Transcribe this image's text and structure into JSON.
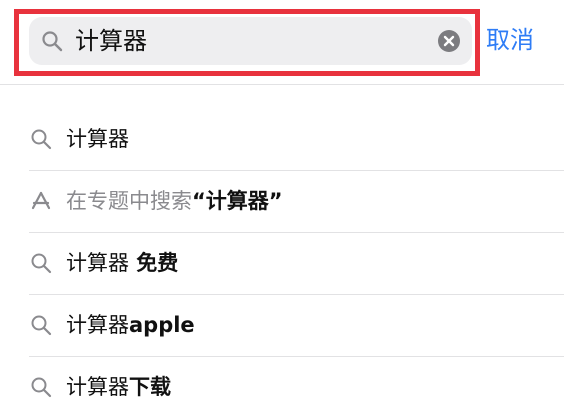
{
  "search": {
    "query": "计算器",
    "cancel_label": "取消"
  },
  "colors": {
    "highlight_border": "#e8323d",
    "link_blue": "#2e7cf6",
    "field_background": "#eeeef0",
    "secondary_text": "#8a8a8e"
  },
  "suggestions": [
    {
      "icon": "search-icon",
      "text": "计算器"
    },
    {
      "icon": "app-store-icon",
      "prefix": "在专题中搜索",
      "term": "“计算器”"
    },
    {
      "icon": "search-icon",
      "base": "计算器",
      "rest": " 免费"
    },
    {
      "icon": "search-icon",
      "base": "计算器",
      "rest": "apple"
    },
    {
      "icon": "search-icon",
      "base": "计算器",
      "rest": "下载"
    }
  ]
}
